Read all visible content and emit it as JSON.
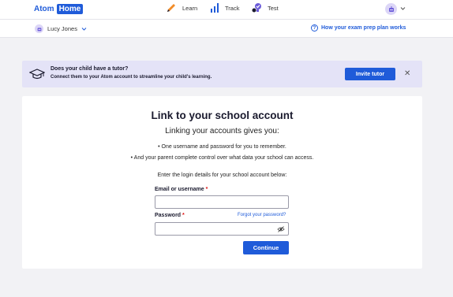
{
  "header": {
    "logo_atom": "Atom",
    "logo_home": "Home",
    "nav": [
      {
        "label": "Learn",
        "icon": "pencil-icon"
      },
      {
        "label": "Track",
        "icon": "bar-chart-icon"
      },
      {
        "label": "Test",
        "icon": "test-shapes-icon"
      }
    ],
    "avatar_icon": "robot-avatar-icon"
  },
  "subheader": {
    "user_name": "Lucy Jones",
    "help_link": "How your exam prep plan works"
  },
  "banner": {
    "title": "Does your child have a tutor?",
    "text": "Connect them to your Atom account to streamline your child's learning.",
    "button": "Invite tutor",
    "close_symbol": "✕"
  },
  "form": {
    "title": "Link to your school account",
    "subtitle": "Linking your accounts gives you:",
    "bullets": [
      "• One username and password for you to remember.",
      "• And your parent complete control over what data your school can access."
    ],
    "instructions": "Enter the login details for your school account below:",
    "email_label": "Email or username",
    "password_label": "Password",
    "required_mark": "*",
    "email_value": "",
    "password_value": "",
    "forgot_link": "Forgot your password?",
    "continue_button": "Continue"
  },
  "colors": {
    "brand_blue": "#1f5bd9",
    "banner_bg": "#e4e3f7",
    "page_bg": "#f2f2f5"
  }
}
